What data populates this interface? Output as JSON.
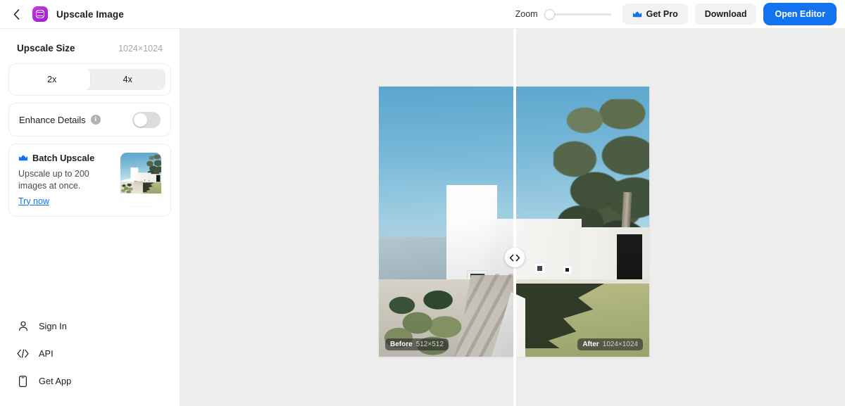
{
  "header": {
    "back_icon": "chevron-left-icon",
    "app_icon": "upscale-app-icon",
    "title": "Upscale Image",
    "zoom_label": "Zoom",
    "zoom_value": "0",
    "get_pro_label": "Get Pro",
    "get_pro_icon": "crown-icon",
    "download_label": "Download",
    "open_editor_label": "Open Editor",
    "accent_blue": "#1272f0"
  },
  "sidebar": {
    "upscale_size_label": "Upscale Size",
    "upscale_size_value": "1024×1024",
    "scale_options": [
      {
        "label": "2x",
        "selected": true
      },
      {
        "label": "4x",
        "selected": false
      }
    ],
    "enhance": {
      "label": "Enhance Details",
      "info_icon": "info-icon",
      "info_glyph": "i",
      "toggle_state": "off"
    },
    "batch": {
      "icon": "crown-icon",
      "title": "Batch Upscale",
      "description": "Upscale up to 200 images at once.",
      "link_label": "Try now",
      "thumbnail_alt": "batch-upscale-thumbnail"
    },
    "nav": [
      {
        "label": "Sign In",
        "icon": "person-icon"
      },
      {
        "label": "API",
        "icon": "code-brackets-icon"
      },
      {
        "label": "Get App",
        "icon": "phone-icon"
      }
    ]
  },
  "canvas": {
    "before_badge_label": "Before",
    "before_badge_value": "512×512",
    "after_badge_label": "After",
    "after_badge_value": "1024×1024",
    "slider_handle_icon": "left-right-chevrons-icon"
  }
}
